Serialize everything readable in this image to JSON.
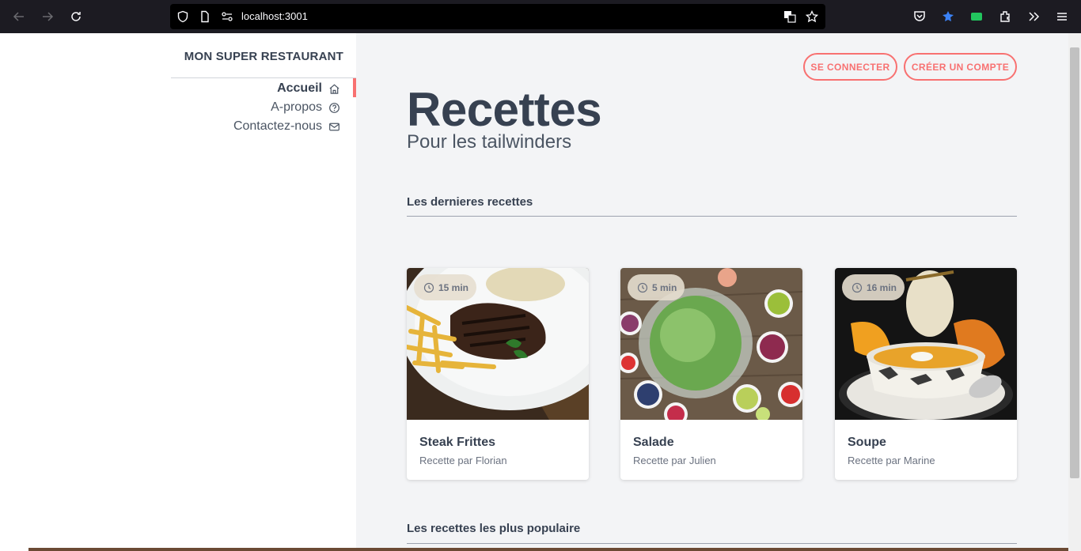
{
  "browser": {
    "url": "localhost:3001"
  },
  "sidebar": {
    "brand": "MON SUPER RESTAURANT",
    "items": [
      {
        "label": "Accueil",
        "icon": "home-icon",
        "active": true
      },
      {
        "label": "A-propos",
        "icon": "help-circle-icon",
        "active": false
      },
      {
        "label": "Contactez-nous",
        "icon": "mail-icon",
        "active": false
      }
    ]
  },
  "header": {
    "login_label": "SE CONNECTER",
    "signup_label": "CRÉER UN COMPTE"
  },
  "hero": {
    "title": "Recettes",
    "subtitle": "Pour les tailwinders"
  },
  "sections": {
    "latest": "Les dernieres recettes",
    "popular": "Les recettes les plus populaire"
  },
  "recipes": [
    {
      "title": "Steak Frittes",
      "author": "Recette par Florian",
      "time": "15 min"
    },
    {
      "title": "Salade",
      "author": "Recette par Julien",
      "time": "5 min"
    },
    {
      "title": "Soupe",
      "author": "Recette par Marine",
      "time": "16 min"
    }
  ],
  "colors": {
    "accent": "#f87171",
    "text": "#374151",
    "page_bg": "#f3f4f6"
  }
}
